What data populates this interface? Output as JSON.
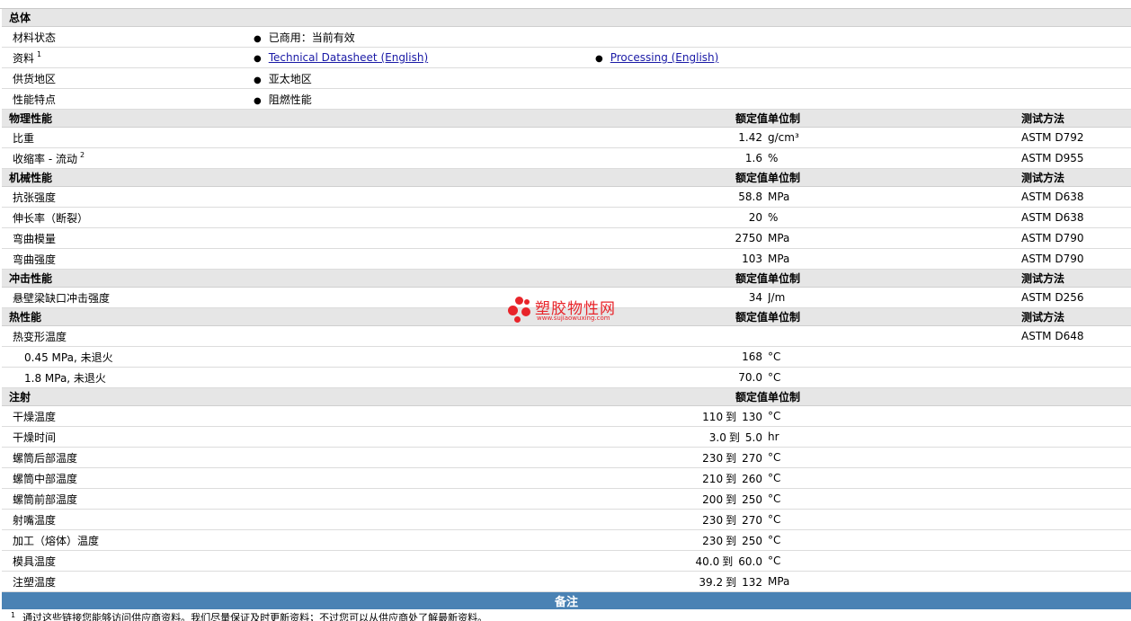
{
  "general": {
    "section_title": "总体",
    "rows": [
      {
        "label": "材料状态",
        "bullets": [
          "已商用：当前有效"
        ]
      },
      {
        "label": "资料",
        "sup": "1",
        "bullets": [
          "Technical Datasheet (English)",
          "Processing (English)"
        ]
      },
      {
        "label": "供货地区",
        "bullets": [
          "亚太地区"
        ]
      },
      {
        "label": "性能特点",
        "bullets": [
          "阻燃性能"
        ]
      }
    ]
  },
  "headers": {
    "rated": "额定值",
    "unit": "单位制",
    "test": "测试方法"
  },
  "sections": [
    {
      "title": "物理性能",
      "show_test": true,
      "rows": [
        {
          "label": "比重",
          "value": "1.42",
          "unit": "g/cm³",
          "test": "ASTM D792"
        },
        {
          "label": "收缩率 - 流动",
          "sup": "2",
          "value": "1.6",
          "unit": "%",
          "test": "ASTM D955"
        }
      ]
    },
    {
      "title": "机械性能",
      "show_test": true,
      "rows": [
        {
          "label": "抗张强度",
          "value": "58.8",
          "unit": "MPa",
          "test": "ASTM D638"
        },
        {
          "label": "伸长率（断裂）",
          "value": "20",
          "unit": "%",
          "test": "ASTM D638"
        },
        {
          "label": "弯曲模量",
          "value": "2750",
          "unit": "MPa",
          "test": "ASTM D790"
        },
        {
          "label": "弯曲强度",
          "value": "103",
          "unit": "MPa",
          "test": "ASTM D790"
        }
      ]
    },
    {
      "title": "冲击性能",
      "show_test": true,
      "rows": [
        {
          "label": "悬壁梁缺口冲击强度",
          "value": "34",
          "unit": "J/m",
          "test": "ASTM D256"
        }
      ]
    },
    {
      "title": "热性能",
      "show_test": true,
      "rows": [
        {
          "label": "热变形温度",
          "value": "",
          "unit": "",
          "test": "ASTM D648"
        },
        {
          "label": "0.45 MPa, 未退火",
          "indent": true,
          "value": "168",
          "unit": "°C",
          "test": ""
        },
        {
          "label": "1.8 MPa, 未退火",
          "indent": true,
          "value": "70.0",
          "unit": "°C",
          "test": ""
        }
      ]
    },
    {
      "title": "注射",
      "show_test": false,
      "rows": [
        {
          "label": "干燥温度",
          "from": "110",
          "to": "130",
          "unit": "°C"
        },
        {
          "label": "干燥时间",
          "from": "3.0",
          "to": "5.0",
          "unit": "hr"
        },
        {
          "label": "螺筒后部温度",
          "from": "230",
          "to": "270",
          "unit": "°C"
        },
        {
          "label": "螺筒中部温度",
          "from": "210",
          "to": "260",
          "unit": "°C"
        },
        {
          "label": "螺筒前部温度",
          "from": "200",
          "to": "250",
          "unit": "°C"
        },
        {
          "label": "射嘴温度",
          "from": "230",
          "to": "270",
          "unit": "°C"
        },
        {
          "label": "加工（熔体）温度",
          "from": "230",
          "to": "250",
          "unit": "°C"
        },
        {
          "label": "模具温度",
          "from": "40.0",
          "to": "60.0",
          "unit": "°C"
        },
        {
          "label": "注塑温度",
          "from": "39.2",
          "to": "132",
          "unit": "MPa"
        }
      ]
    }
  ],
  "range_word": "到",
  "remarks": {
    "title": "备注"
  },
  "footnote": {
    "sup": "1",
    "text": "通过这些链接您能够访问供应商资料。我们尽量保证及时更新资料；不过您可以从供应商处了解最新资料。"
  },
  "watermark": {
    "title": "塑胶物性网",
    "url": "www.sujiaowuxing.com"
  },
  "colors": {
    "section_bg": "#e6e6e6",
    "remark_bg": "#4a82b4",
    "link": "#1a1aa6",
    "watermark": "#e8242a"
  }
}
